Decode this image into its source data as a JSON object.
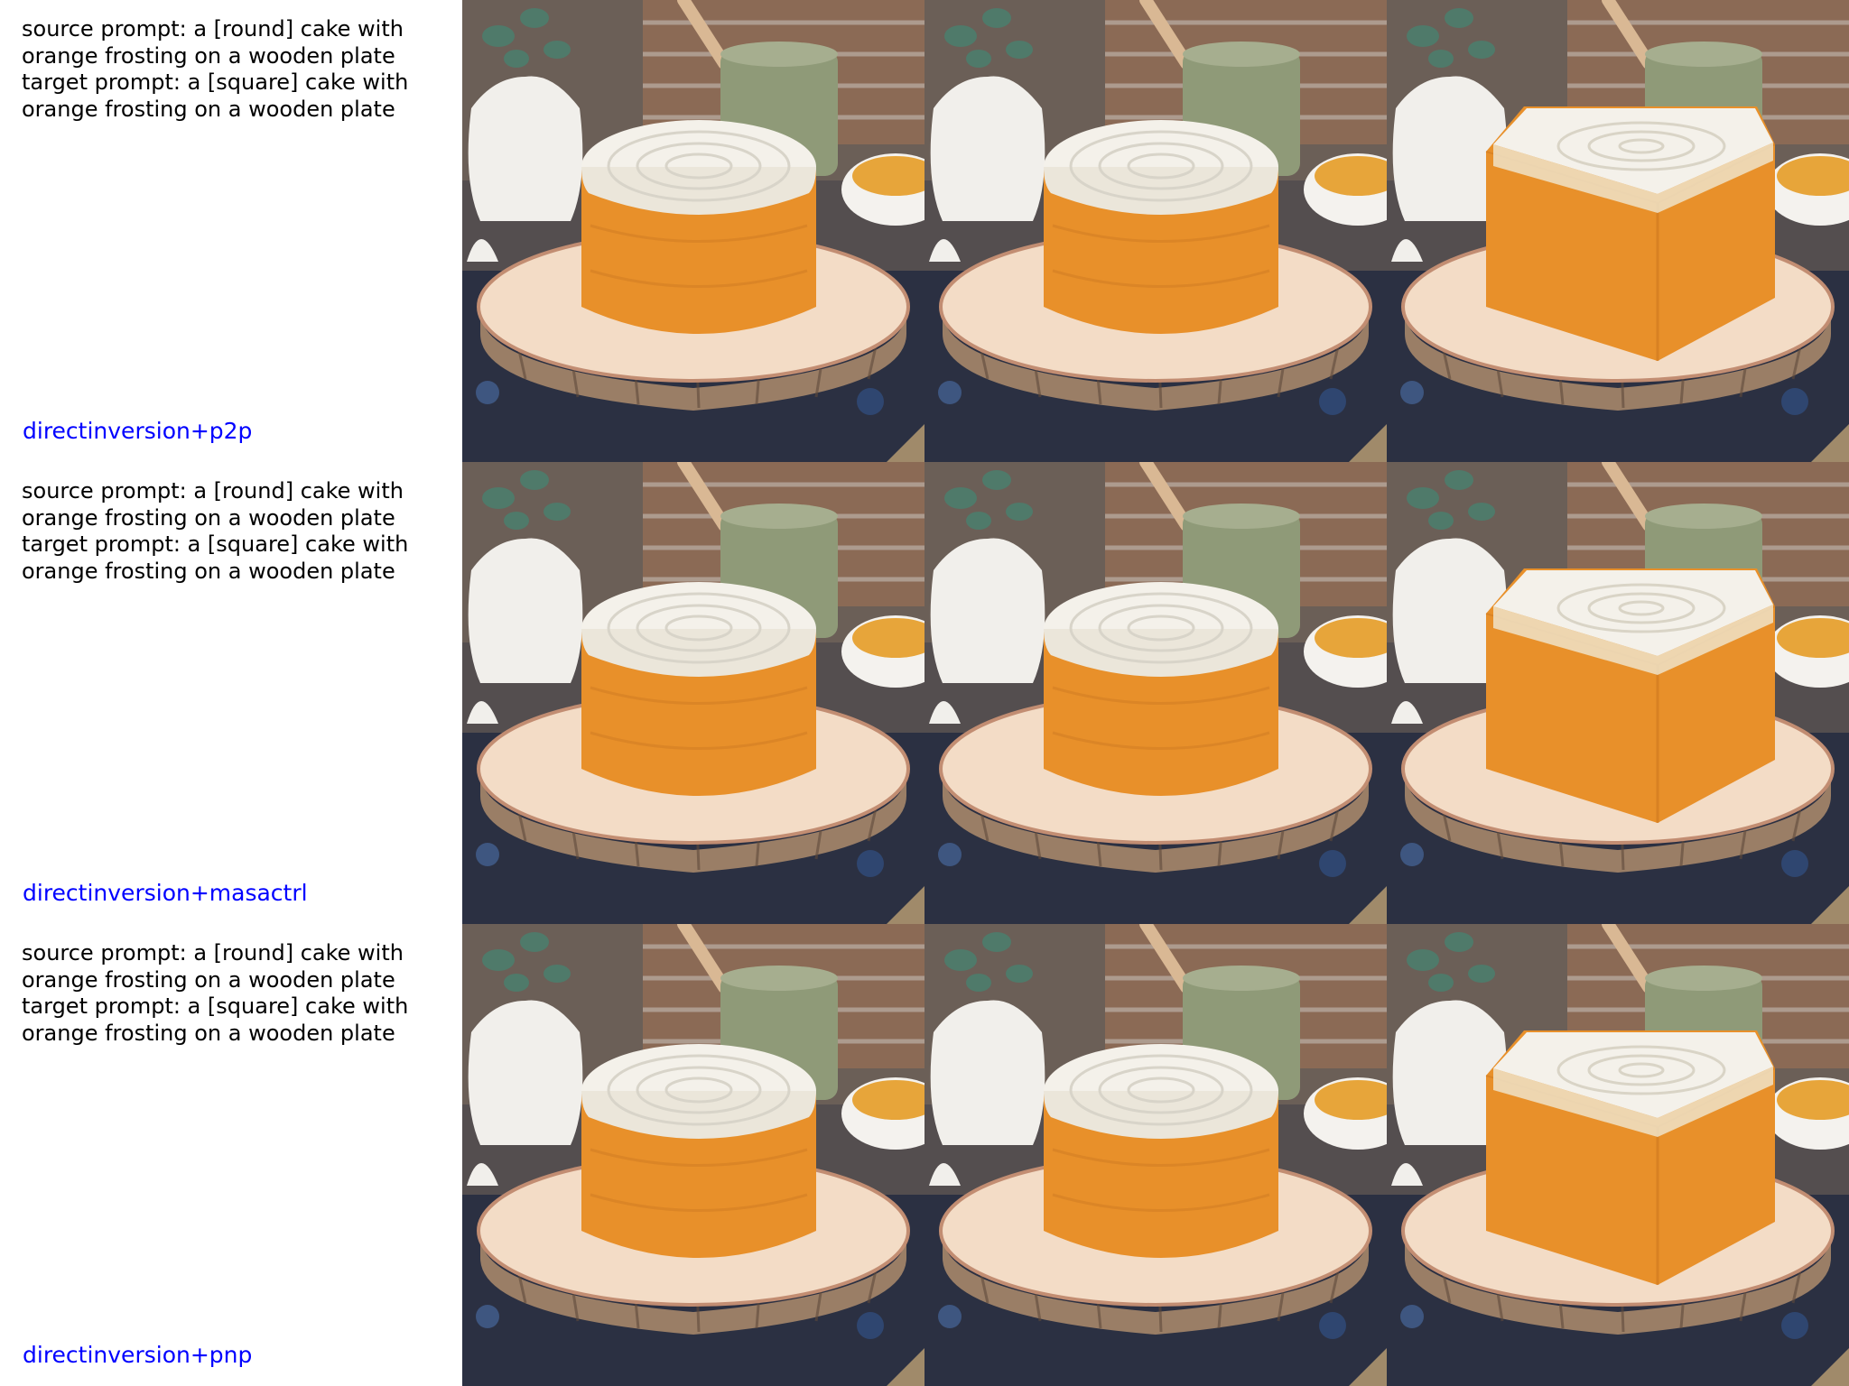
{
  "rows": [
    {
      "source_prompt": "source prompt: a [round] cake with orange frosting on a wooden plate",
      "target_prompt": "target prompt: a [square] cake with orange frosting on a wooden plate",
      "prompt_lines": [
        "source prompt: a [round] cake with",
        "orange frosting on a wooden plate",
        "target prompt: a [square] cake with",
        "orange frosting on a wooden plate"
      ],
      "method": "directinversion+p2p",
      "tiles": [
        {
          "shape": "round"
        },
        {
          "shape": "round"
        },
        {
          "shape": "square"
        }
      ]
    },
    {
      "source_prompt": "source prompt: a [round] cake with orange frosting on a wooden plate",
      "target_prompt": "target prompt: a [square] cake with orange frosting on a wooden plate",
      "prompt_lines": [
        "source prompt: a [round] cake with",
        "orange frosting on a wooden plate",
        "target prompt: a [square] cake with",
        "orange frosting on a wooden plate"
      ],
      "method": "directinversion+masactrl",
      "tiles": [
        {
          "shape": "round"
        },
        {
          "shape": "round"
        },
        {
          "shape": "square"
        }
      ]
    },
    {
      "source_prompt": "source prompt: a [round] cake with orange frosting on a wooden plate",
      "target_prompt": "target prompt: a [square] cake with orange frosting on a wooden plate",
      "prompt_lines": [
        "source prompt: a [round] cake with",
        "orange frosting on a wooden plate",
        "target prompt: a [square] cake with",
        "orange frosting on a wooden plate"
      ],
      "method": "directinversion+pnp",
      "tiles": [
        {
          "shape": "round"
        },
        {
          "shape": "round"
        },
        {
          "shape": "square"
        }
      ]
    }
  ],
  "colors": {
    "prompt_text": "#000000",
    "method_label": "#0000ff",
    "background": "#ffffff",
    "cake_sponge": "#e8902a",
    "frosting": "#f4f1ea",
    "tablecloth": "#2b3142",
    "wood_plate": "#f3dcc6",
    "bark": "#9a7e66"
  }
}
